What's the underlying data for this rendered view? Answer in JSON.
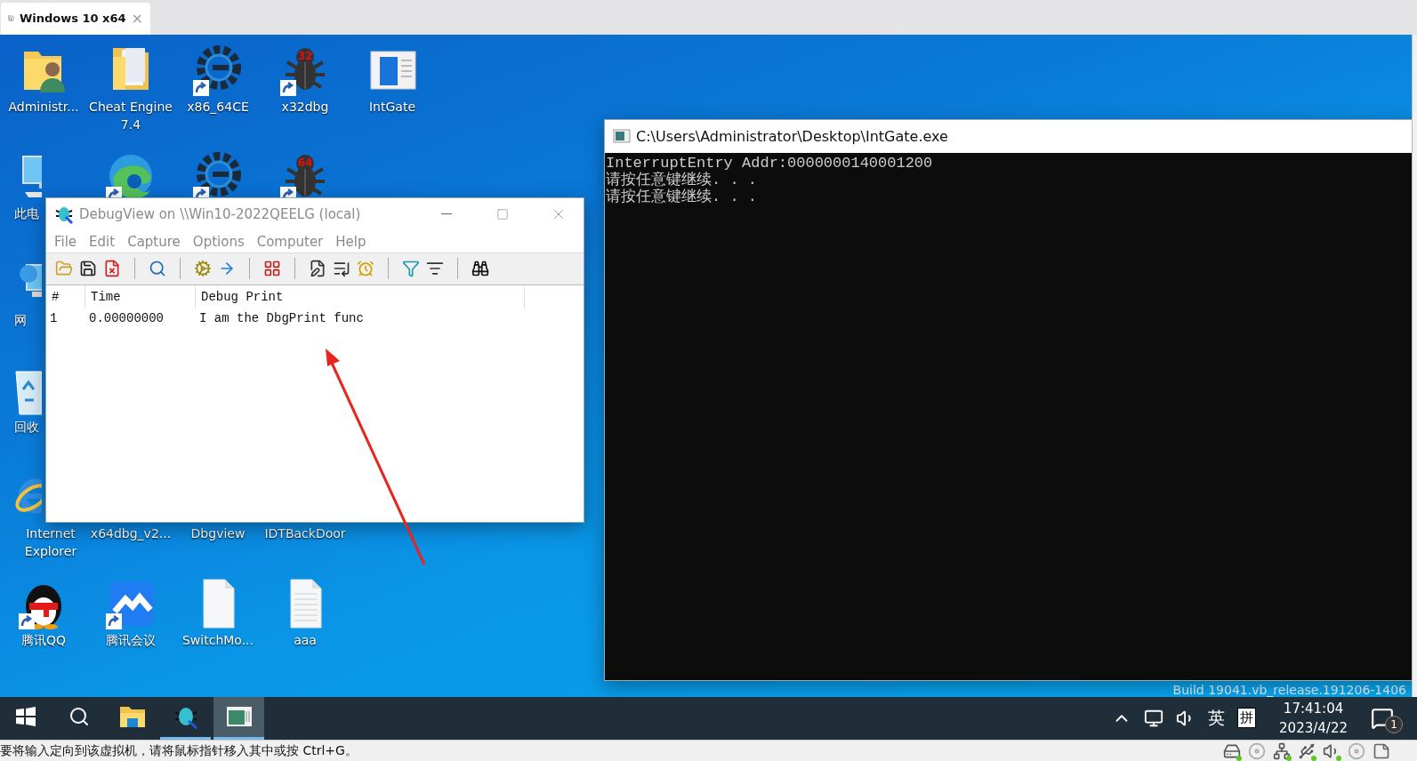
{
  "vm_tab": {
    "title": "Windows 10 x64",
    "close": "×",
    "selected": true
  },
  "desktop": {
    "icon_rows": [
      [
        {
          "kind": "user-folder",
          "label": "Administr...",
          "shortcut": false
        },
        {
          "kind": "folder",
          "label": "Cheat Engine 7.4",
          "shortcut": false
        },
        {
          "kind": "gear",
          "label": "x86_64CE",
          "shortcut": true
        },
        {
          "kind": "bug",
          "label": "x32dbg",
          "badge": "32",
          "shortcut": true
        },
        {
          "kind": "app-window",
          "label": "IntGate",
          "shortcut": false
        }
      ],
      [
        {
          "kind": "monitor",
          "label": "此电",
          "cut": true,
          "shortcut": false
        },
        {
          "kind": "swirl",
          "shortcut": true
        },
        {
          "kind": "gear",
          "shortcut": true
        },
        {
          "kind": "bug",
          "badge": "64",
          "shortcut": true
        }
      ],
      [
        {
          "kind": "network",
          "label": "网",
          "cut": true,
          "shortcut": false
        }
      ],
      [
        {
          "kind": "recycle",
          "label": "回收",
          "cut": true,
          "shortcut": false
        }
      ],
      [
        {
          "kind": "orbit",
          "label": "Internet Explorer",
          "cut": true,
          "shortcut": false
        },
        {
          "label": "x64dbg_v2..."
        },
        {
          "label": "Dbgview"
        },
        {
          "label": "IDTBackDoor"
        }
      ],
      [
        {
          "kind": "penguin",
          "label": "腾讯QQ",
          "shortcut": true
        },
        {
          "kind": "meeting",
          "label": "腾讯会议",
          "shortcut": true
        },
        {
          "kind": "file",
          "label": "SwitchMo...",
          "shortcut": false
        },
        {
          "kind": "document",
          "label": "aaa",
          "shortcut": false
        }
      ]
    ],
    "build_text": "Build 19041.vb_release.191206-1406"
  },
  "console": {
    "title": "C:\\Users\\Administrator\\Desktop\\IntGate.exe",
    "lines": [
      "InterruptEntry Addr:0000000140001200",
      "请按任意键继续. . .",
      "请按任意键继续. . ."
    ]
  },
  "debugview": {
    "title": "DebugView on \\\\Win10-2022QEELG (local)",
    "menu": [
      "File",
      "Edit",
      "Capture",
      "Options",
      "Computer",
      "Help"
    ],
    "toolbar": [
      {
        "kind": "open"
      },
      {
        "kind": "save"
      },
      {
        "kind": "clear"
      },
      {
        "kind": "separator"
      },
      {
        "kind": "find"
      },
      {
        "kind": "separator"
      },
      {
        "kind": "capture"
      },
      {
        "kind": "forward"
      },
      {
        "kind": "separator"
      },
      {
        "kind": "windows"
      },
      {
        "kind": "separator"
      },
      {
        "kind": "highlight"
      },
      {
        "kind": "autoscroll"
      },
      {
        "kind": "clock"
      },
      {
        "kind": "separator"
      },
      {
        "kind": "filter"
      },
      {
        "kind": "history"
      },
      {
        "kind": "separator"
      },
      {
        "kind": "binoculars"
      }
    ],
    "columns": [
      "#",
      "Time",
      "Debug Print"
    ],
    "rows": [
      [
        "1",
        "0.00000000",
        "I am the DbgPrint func"
      ]
    ]
  },
  "taskbar": {
    "apps": [
      {
        "kind": "start",
        "running": false,
        "selected": false
      },
      {
        "kind": "search",
        "running": false,
        "selected": false
      },
      {
        "kind": "explorer",
        "running": false,
        "selected": false
      },
      {
        "kind": "debugview",
        "running": true,
        "selected": false
      },
      {
        "kind": "console",
        "running": true,
        "selected": true
      }
    ],
    "ime_lang": "英",
    "ime_mode": "拼",
    "time": "17:41:04",
    "date": "2023/4/22",
    "notifications": "1"
  },
  "status_bar": {
    "message": "要将输入定向到该虚拟机，请将鼠标指针移入其中或按 Ctrl+G。",
    "devices": [
      {
        "kind": "disk",
        "active": true
      },
      {
        "kind": "cd",
        "active": false
      },
      {
        "kind": "network",
        "active": true
      },
      {
        "kind": "usb",
        "active": true
      },
      {
        "kind": "sound",
        "active": true
      },
      {
        "kind": "cd",
        "active": false
      }
    ]
  }
}
